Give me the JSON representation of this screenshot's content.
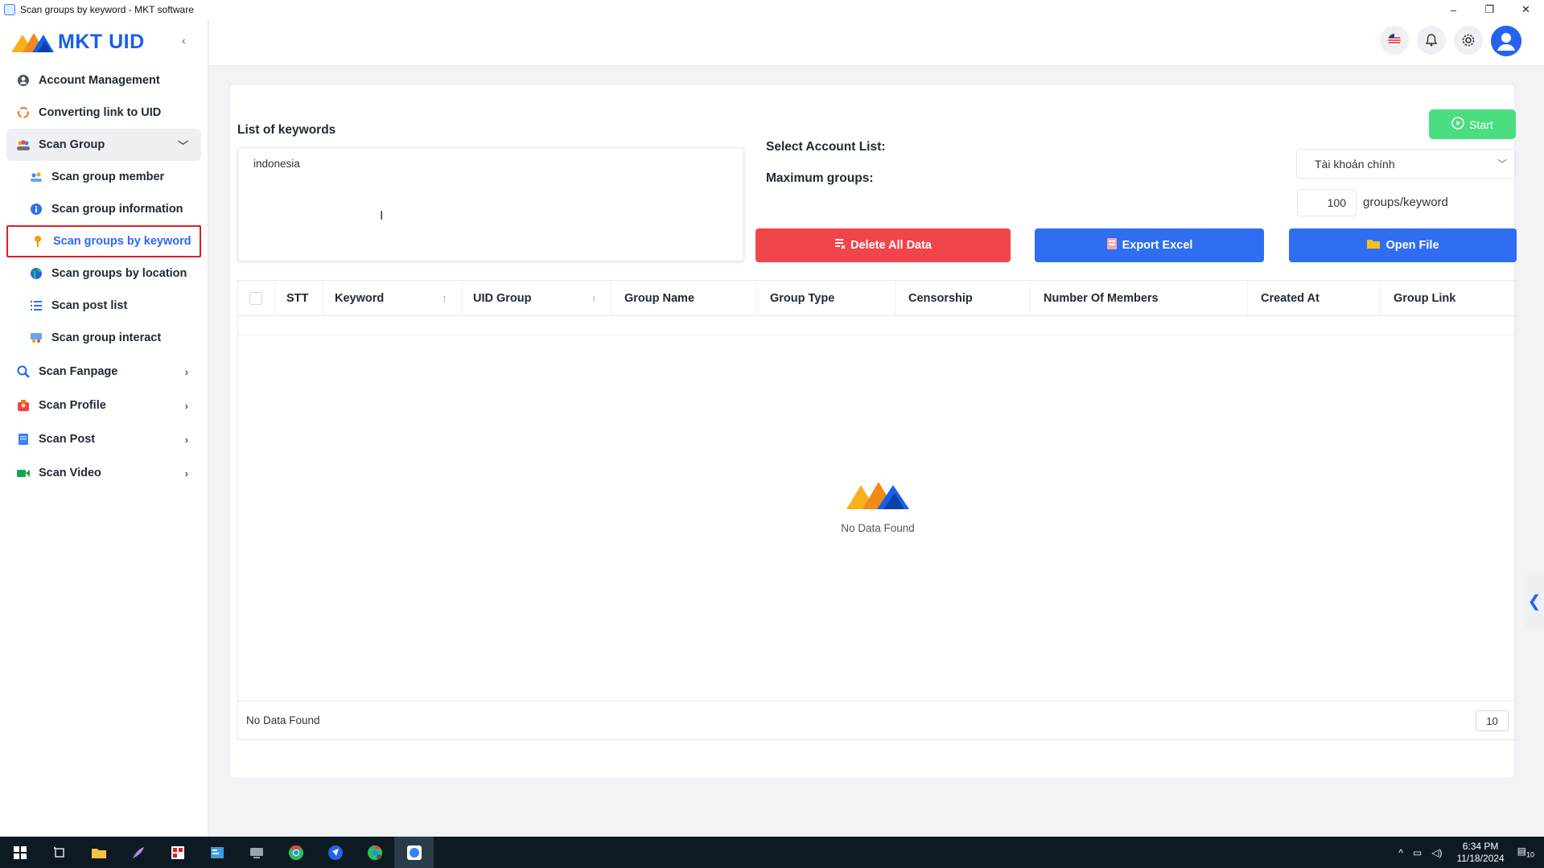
{
  "window": {
    "title": "Scan groups by keyword - MKT software",
    "controls": [
      "–",
      "❐",
      "✕"
    ]
  },
  "sidebar": {
    "logo_text": "MKT UID",
    "collapse_icon": "‹",
    "items": [
      {
        "label": "Account Management",
        "icon": "user-circle-icon"
      },
      {
        "label": "Converting link to UID",
        "icon": "refresh-icon"
      },
      {
        "label": "Scan Group",
        "icon": "group-icon"
      },
      {
        "label": "Scan group member",
        "icon": "member-icon"
      },
      {
        "label": "Scan group information",
        "icon": "info-icon"
      },
      {
        "label": "Scan groups by keyword",
        "icon": "key-icon"
      },
      {
        "label": "Scan groups by location",
        "icon": "globe-icon"
      },
      {
        "label": "Scan post list",
        "icon": "list-icon"
      },
      {
        "label": "Scan group interact",
        "icon": "interact-icon"
      },
      {
        "label": "Scan Fanpage",
        "icon": "search-icon"
      },
      {
        "label": "Scan Profile",
        "icon": "profile-icon"
      },
      {
        "label": "Scan Post",
        "icon": "post-icon"
      },
      {
        "label": "Scan Video",
        "icon": "video-icon"
      }
    ]
  },
  "main": {
    "keywords_title": "List of keywords",
    "keywords_value": "indonesia",
    "start_label": "Start",
    "select_account_label": "Select Account List:",
    "account_value": "Tài khoản chính",
    "max_groups_label": "Maximum groups:",
    "max_groups_value": "100",
    "max_groups_unit": "groups/keyword",
    "delete_label": "Delete All Data",
    "export_label": "Export Excel",
    "open_label": "Open File",
    "columns": [
      "STT",
      "Keyword",
      "UID Group",
      "Group Name",
      "Group Type",
      "Censorship",
      "Number Of Members",
      "Created At",
      "Group Link"
    ],
    "empty_text": "No Data Found",
    "footer_text": "No Data Found",
    "page_size": "10"
  },
  "taskbar": {
    "time": "6:34 PM",
    "date": "11/18/2024",
    "notif": "10"
  },
  "colors": {
    "accent": "#2f6ef0",
    "danger": "#f0454a",
    "success": "#4ade80",
    "active_link": "#2f67f6",
    "highlight_border": "#e11d24"
  }
}
